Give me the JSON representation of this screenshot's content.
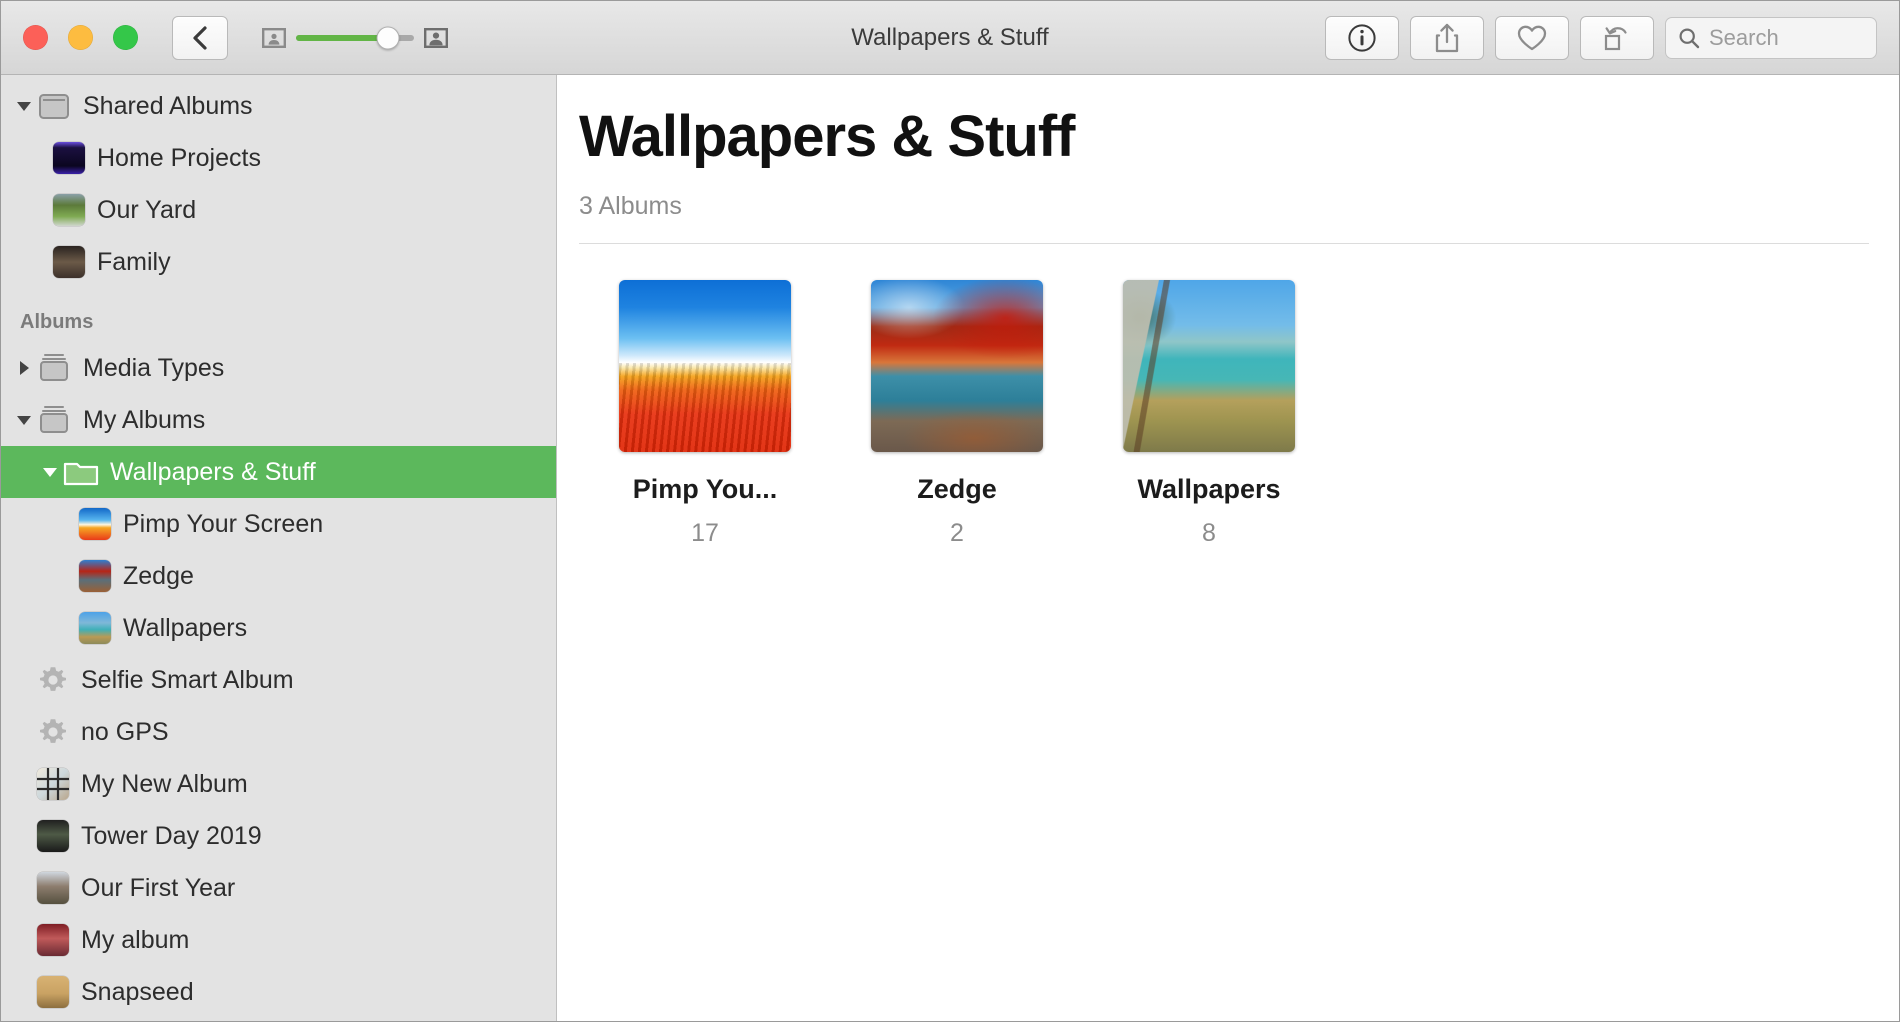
{
  "window": {
    "title": "Wallpapers & Stuff",
    "traffic_lights": [
      "close",
      "minimize",
      "zoom"
    ]
  },
  "toolbar": {
    "back_label": "Back",
    "back_icon": "chevron-left-icon",
    "zoom_out_icon": "small-thumbnail-icon",
    "zoom_in_icon": "large-thumbnail-icon",
    "slider": {
      "value": 78,
      "min": 0,
      "max": 100,
      "fill_color": "#62b546"
    },
    "info_icon": "info-circle-icon",
    "share_icon": "share-icon",
    "favorite_icon": "heart-icon",
    "rotate_icon": "rotate-icon",
    "search": {
      "placeholder": "Search",
      "value": "",
      "icon": "search-icon"
    }
  },
  "sidebar": {
    "sections": [
      {
        "header": null,
        "items": [
          {
            "label": "Shared Albums",
            "icon": "shared-albums-icon",
            "indent": 0,
            "disclosure": "down",
            "selected": false
          },
          {
            "label": "Home Projects",
            "icon": "album-thumbnail",
            "art": "art-home",
            "indent": 1,
            "disclosure": null,
            "selected": false
          },
          {
            "label": "Our Yard",
            "icon": "album-thumbnail",
            "art": "art-yard",
            "indent": 1,
            "disclosure": null,
            "selected": false
          },
          {
            "label": "Family",
            "icon": "album-thumbnail",
            "art": "art-family",
            "indent": 1,
            "disclosure": null,
            "selected": false
          }
        ]
      },
      {
        "header": "Albums",
        "items": [
          {
            "label": "Media Types",
            "icon": "album-stack-icon",
            "indent": 0,
            "disclosure": "right",
            "selected": false
          },
          {
            "label": "My Albums",
            "icon": "album-stack-icon",
            "indent": 0,
            "disclosure": "down",
            "selected": false
          },
          {
            "label": "Wallpapers & Stuff",
            "icon": "folder-icon",
            "indent": 2,
            "disclosure": "down",
            "selected": true
          },
          {
            "label": "Pimp Your Screen",
            "icon": "album-thumbnail",
            "art": "art-pimp",
            "indent": 3,
            "disclosure": null,
            "selected": false
          },
          {
            "label": "Zedge",
            "icon": "album-thumbnail",
            "art": "art-zedge",
            "indent": 3,
            "disclosure": null,
            "selected": false
          },
          {
            "label": "Wallpapers",
            "icon": "album-thumbnail",
            "art": "art-wall",
            "indent": 3,
            "disclosure": null,
            "selected": false
          },
          {
            "label": "Selfie Smart Album",
            "icon": "gear-icon",
            "indent": 2,
            "disclosure": null,
            "selected": false
          },
          {
            "label": "no GPS",
            "icon": "gear-icon",
            "indent": 2,
            "disclosure": null,
            "selected": false
          },
          {
            "label": "My New Album",
            "icon": "album-thumbnail",
            "art": "art-newalb",
            "indent": 2,
            "disclosure": null,
            "selected": false
          },
          {
            "label": "Tower Day 2019",
            "icon": "album-thumbnail",
            "art": "art-tower",
            "indent": 2,
            "disclosure": null,
            "selected": false
          },
          {
            "label": "Our First Year",
            "icon": "album-thumbnail",
            "art": "art-first",
            "indent": 2,
            "disclosure": null,
            "selected": false
          },
          {
            "label": "My album",
            "icon": "album-thumbnail",
            "art": "art-myalb",
            "indent": 2,
            "disclosure": null,
            "selected": false
          },
          {
            "label": "Snapseed",
            "icon": "album-thumbnail",
            "art": "art-snap",
            "indent": 2,
            "disclosure": null,
            "selected": false
          }
        ]
      }
    ],
    "selection_color": "#5cb85c"
  },
  "main": {
    "title": "Wallpapers & Stuff",
    "subtitle": "3 Albums",
    "albums": [
      {
        "name": "Pimp You...",
        "full_name": "Pimp Your Screen",
        "count": "17",
        "art": "big-pimp"
      },
      {
        "name": "Zedge",
        "full_name": "Zedge",
        "count": "2",
        "art": "big-zedge"
      },
      {
        "name": "Wallpapers",
        "full_name": "Wallpapers",
        "count": "8",
        "art": "big-wall"
      }
    ]
  }
}
